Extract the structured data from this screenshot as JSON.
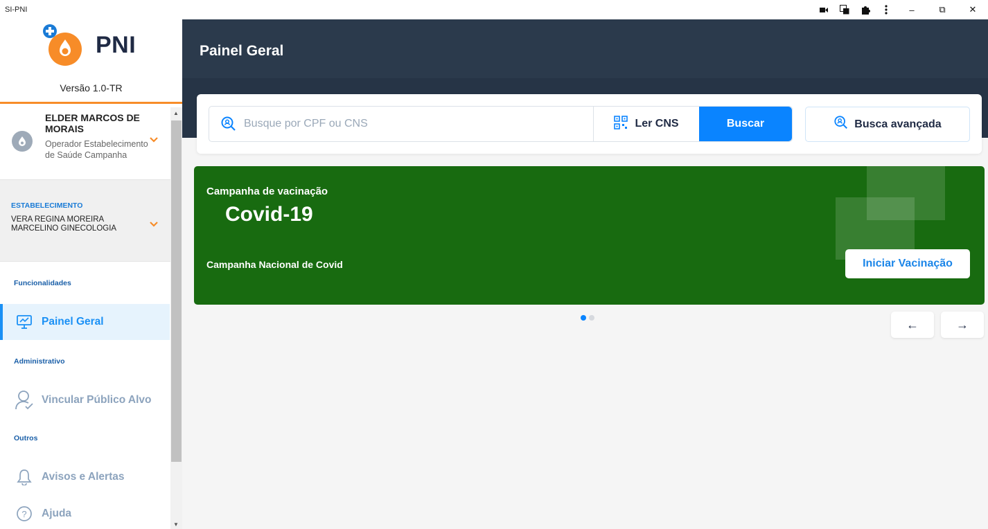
{
  "window": {
    "title": "SI-PNI",
    "controls": [
      "camera-icon",
      "translate-icon",
      "extension-icon",
      "more-icon",
      "minimize-icon",
      "restore-icon",
      "close-icon"
    ],
    "minimize_glyph": "–",
    "restore_glyph": "⧉",
    "close_glyph": "✕"
  },
  "sidebar": {
    "logo_text": "PNI",
    "version": "Versão 1.0-TR",
    "user": {
      "name": "ELDER MARCOS DE MORAIS",
      "role": "Operador Estabelecimento de Saúde Campanha"
    },
    "establishment": {
      "label": "ESTABELECIMENTO",
      "name": "VERA REGINA MOREIRA MARCELINO GINECOLOGIA"
    },
    "sections": {
      "funcionalidades": "Funcionalidades",
      "administrativo": "Administrativo",
      "outros": "Outros"
    },
    "items": {
      "painel_geral": "Painel Geral",
      "vincular": "Vincular Público Alvo",
      "avisos": "Avisos e Alertas",
      "ajuda": "Ajuda"
    }
  },
  "header": {
    "title": "Painel Geral"
  },
  "search": {
    "placeholder": "Busque por CPF ou CNS",
    "value": "",
    "ler_cns": "Ler CNS",
    "buscar": "Buscar",
    "busca_avancada": "Busca avançada"
  },
  "banner": {
    "label": "Campanha de vacinação",
    "name": "Covid-19",
    "description": "Campanha Nacional de Covid",
    "button": "Iniciar Vacinação",
    "color": "#186b10"
  },
  "carousel": {
    "active_slide": 1,
    "slide_count": 2,
    "prev_glyph": "←",
    "next_glyph": "→"
  },
  "colors": {
    "accent": "#0a84ff",
    "header": "#2b3a4c",
    "orange": "#f78c28"
  }
}
